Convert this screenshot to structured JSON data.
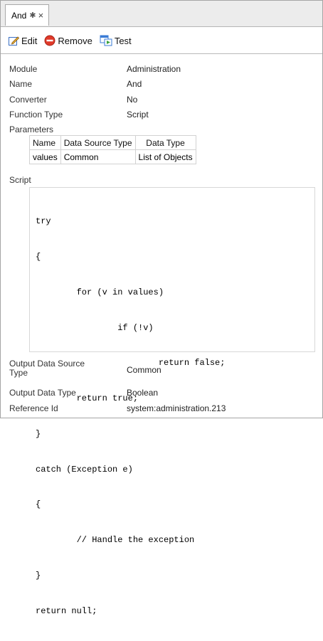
{
  "tab": {
    "title": "And",
    "pin_glyph": "✱",
    "close_glyph": "×"
  },
  "toolbar": {
    "edit_label": "Edit",
    "remove_label": "Remove",
    "test_label": "Test"
  },
  "properties": {
    "module": {
      "label": "Module",
      "value": "Administration"
    },
    "name": {
      "label": "Name",
      "value": "And"
    },
    "converter": {
      "label": "Converter",
      "value": "No"
    },
    "function_type": {
      "label": "Function Type",
      "value": "Script"
    }
  },
  "parameters": {
    "label": "Parameters",
    "columns": [
      "Name",
      "Data Source Type",
      "Data Type"
    ],
    "rows": [
      [
        "values",
        "Common",
        "List of Objects"
      ]
    ]
  },
  "script": {
    "label": "Script",
    "lines": [
      "try",
      "{",
      "        for (v in values)",
      "                if (!v)",
      "                        return false;",
      "        return true;",
      "}",
      "catch (Exception e)",
      "{",
      "        // Handle the exception",
      "}",
      "return null;"
    ]
  },
  "output": {
    "data_source_type": {
      "label_line1": "Output Data Source",
      "label_line2": "Type",
      "value": "Common"
    },
    "data_type": {
      "label": "Output Data Type",
      "value": "Boolean"
    },
    "reference_id": {
      "label": "Reference Id",
      "value": "system:administration.213"
    }
  },
  "icons": {
    "edit": "edit-icon",
    "remove": "remove-icon",
    "test": "test-icon"
  },
  "colors": {
    "remove_red": "#e03a2a",
    "edit_blue": "#3a6fc4",
    "test_blue": "#3a7bd5",
    "test_green": "#3aa33a"
  }
}
